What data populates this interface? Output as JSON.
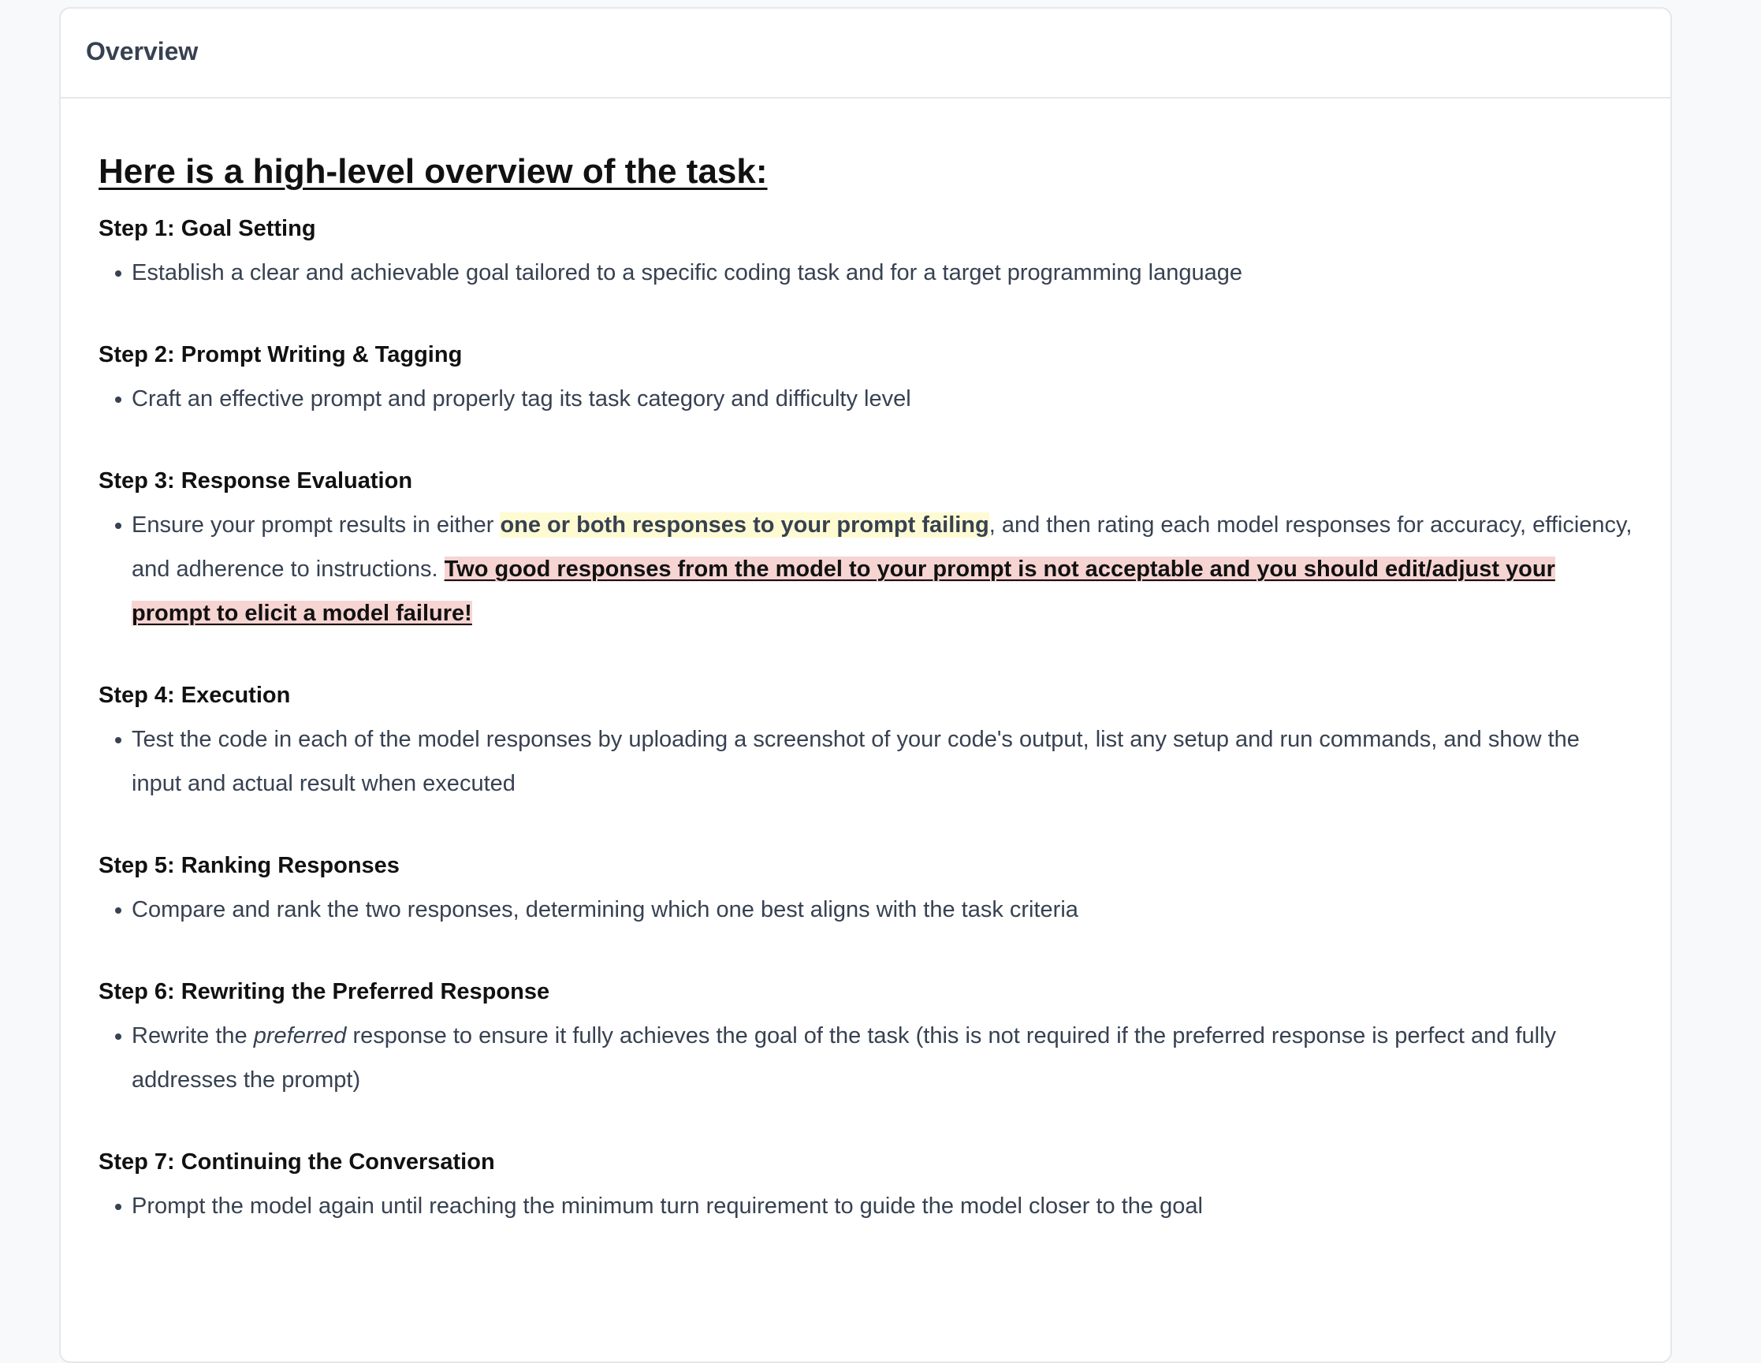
{
  "header": {
    "title": "Overview"
  },
  "content": {
    "heading": "Here is a high-level overview of the task:",
    "steps": [
      {
        "title": "Step 1: Goal Setting",
        "text": "Establish a clear and achievable goal tailored to a specific coding task and for a target programming language"
      },
      {
        "title": "Step 2: Prompt Writing & Tagging",
        "text": "Craft an effective prompt and properly tag its task category and difficulty level"
      },
      {
        "title": "Step 3: Response Evaluation",
        "text_before": "Ensure your prompt results in either ",
        "highlight_yellow": "one or both responses to your prompt failing",
        "text_middle": ", and then rating each model responses for accuracy, efficiency, and adherence to instructions. ",
        "highlight_red": "Two good responses from the model to your prompt is not acceptable and you should edit/adjust your prompt to elicit a model failure!"
      },
      {
        "title": "Step 4: Execution",
        "text": "Test the code in each of the model responses by uploading a screenshot of your code's output, list any setup and run commands, and show the input and actual result when executed"
      },
      {
        "title": "Step 5: Ranking Responses",
        "text": "Compare and rank the two responses, determining which one best aligns with the task criteria"
      },
      {
        "title": "Step 6: Rewriting the Preferred Response",
        "text_before": "Rewrite the ",
        "text_italic": "preferred",
        "text_after": " response to ensure it fully achieves the goal of the task (this is not required if the preferred response is perfect and fully addresses the prompt)"
      },
      {
        "title": "Step 7: Continuing the Conversation",
        "text": "Prompt the model again until reaching the minimum turn requirement to guide the model closer to the goal"
      }
    ]
  },
  "colors": {
    "page_background": "#f8f9fa",
    "card_background": "#ffffff",
    "border": "#e5e7eb",
    "body_text": "#374151",
    "heading_text": "#111111",
    "highlight_yellow": "#fefbd3",
    "highlight_red": "#f6d4d2"
  }
}
